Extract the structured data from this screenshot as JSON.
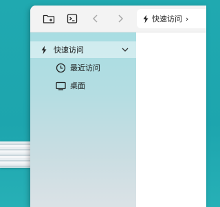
{
  "toolbar": {
    "new_folder_icon": "folder-plus-icon",
    "terminal_icon": "terminal-icon",
    "back_icon": "chevron-left-icon",
    "forward_icon": "chevron-right-icon"
  },
  "address": {
    "icon": "lightning-icon",
    "label": "快速访问",
    "arrow": "›"
  },
  "sidebar": {
    "quick_access": {
      "label": "快速访问",
      "icon": "lightning-icon",
      "expanded": true
    },
    "items": [
      {
        "label": "最近访问",
        "icon": "clock-icon"
      },
      {
        "label": "桌面",
        "icon": "monitor-icon"
      }
    ]
  }
}
